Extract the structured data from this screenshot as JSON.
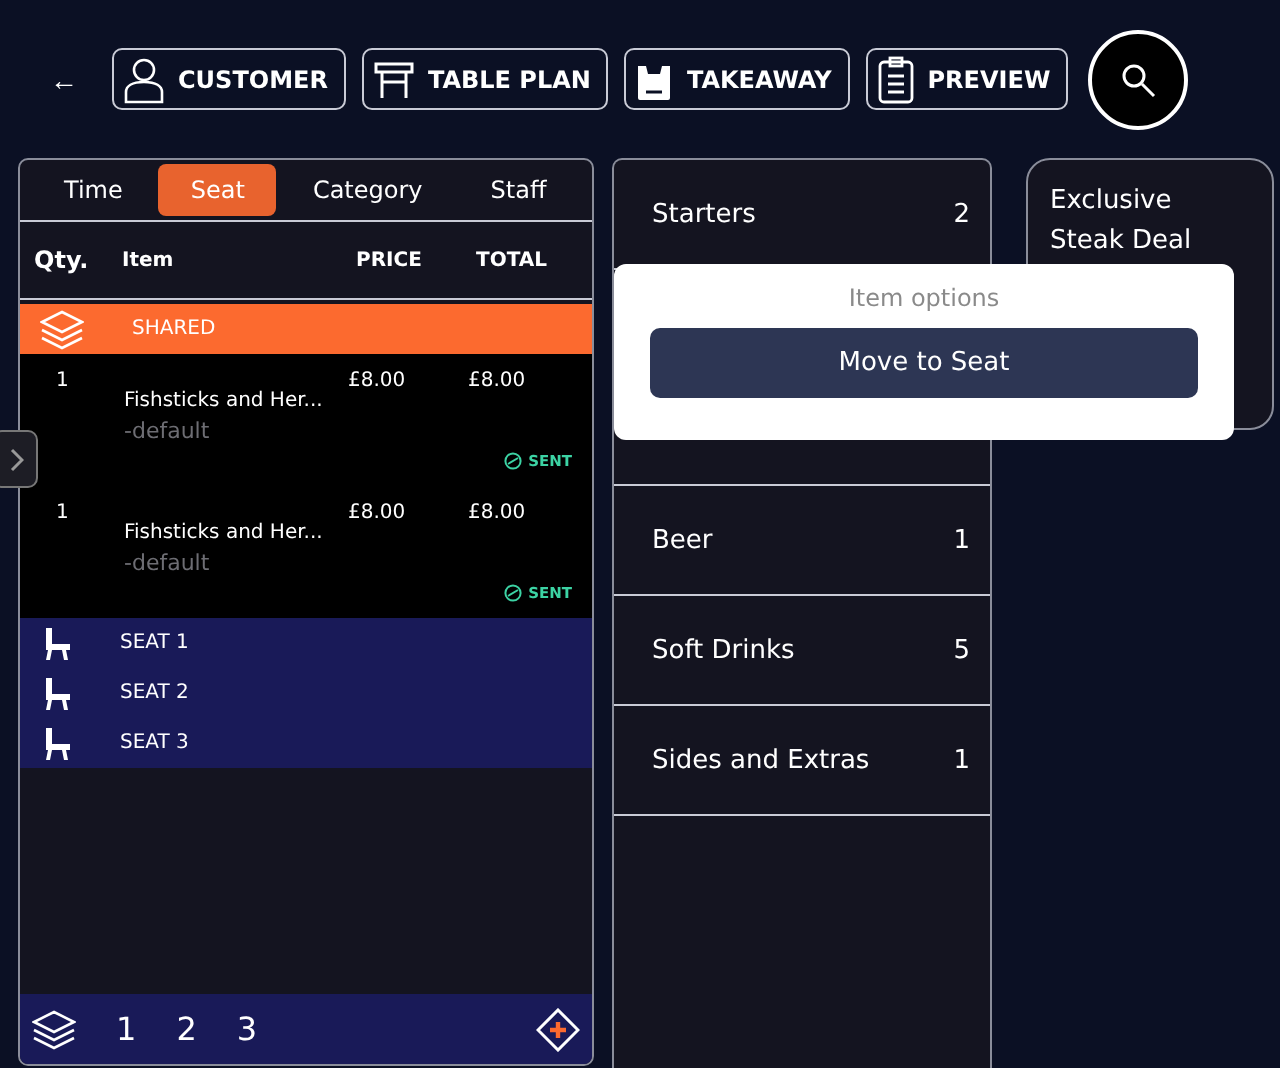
{
  "back": "←",
  "toolbar": [
    {
      "kind": "customer",
      "label": "CUSTOMER"
    },
    {
      "kind": "table",
      "label": "TABLE PLAN"
    },
    {
      "kind": "takeaway",
      "label": "TAKEAWAY"
    },
    {
      "kind": "preview",
      "label": "PREVIEW"
    }
  ],
  "tabs": [
    {
      "label": "Time",
      "selected": false
    },
    {
      "label": "Seat",
      "selected": true
    },
    {
      "label": "Category",
      "selected": false
    },
    {
      "label": "Staff",
      "selected": false
    }
  ],
  "columns": [
    "Qty.",
    "Item",
    "PRICE",
    "TOTAL"
  ],
  "shared": {
    "label": "SHARED"
  },
  "items": [
    {
      "qty": "1",
      "name": "Fishsticks and Her...",
      "modifier": "-default",
      "price": "£8.00",
      "total": "£8.00",
      "status": "SENT"
    },
    {
      "qty": "1",
      "name": "Fishsticks and Her...",
      "modifier": "-default",
      "price": "£8.00",
      "total": "£8.00",
      "status": "SENT"
    }
  ],
  "seats": [
    "SEAT 1",
    "SEAT 2",
    "SEAT 3"
  ],
  "seat_tabs": [
    "1",
    "2",
    "3"
  ],
  "categories": [
    {
      "name": "Starters",
      "count": "2"
    },
    {
      "kind": "hidden"
    },
    {
      "name": "Beer",
      "count": "1"
    },
    {
      "name": "Soft Drinks",
      "count": "5"
    },
    {
      "name": "Sides and Extras",
      "count": "1"
    }
  ],
  "deal": {
    "title": "Exclusive Steak Deal"
  },
  "popup": {
    "title": "Item options",
    "button": "Move to Seat"
  }
}
